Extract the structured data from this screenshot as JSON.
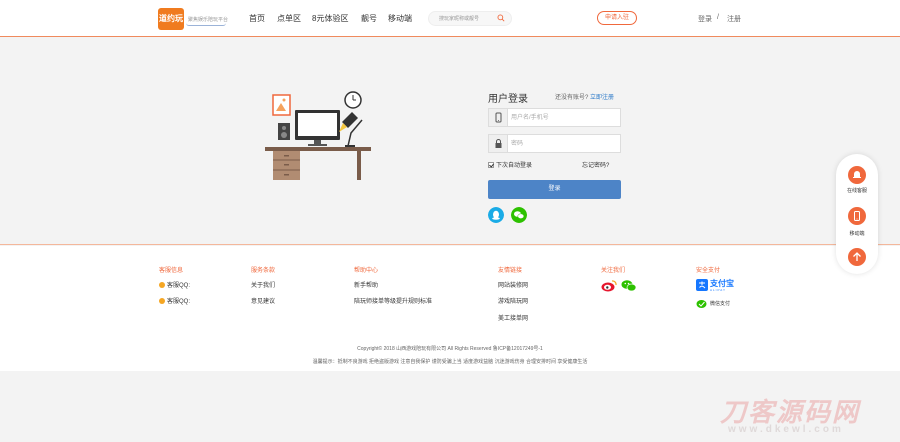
{
  "header": {
    "logo_text": "道约玩",
    "logo_tagline": "聚焦娱乐陪玩平台",
    "nav": [
      "首页",
      "点单区",
      "8元体验区",
      "靓号",
      "移动端"
    ],
    "search_placeholder": "搜玩家昵称或靓号",
    "apply_label": "申请入驻",
    "login": "登录",
    "separator": "/",
    "register": "注册"
  },
  "login": {
    "title": "用户登录",
    "has_account": "还没有账号?",
    "register_link": "立即注册",
    "username_placeholder": "用户名/手机号",
    "password_placeholder": "密码",
    "remember": "下次自动登录",
    "forgot": "忘记密码?",
    "submit": "登录"
  },
  "footer": {
    "columns": [
      {
        "title": "客服信息",
        "items": [
          "客服QQ:",
          "客服QQ:"
        ]
      },
      {
        "title": "服务条款",
        "items": [
          "关于我们",
          "意见建议"
        ]
      },
      {
        "title": "帮助中心",
        "items": [
          "新手帮助",
          "陪玩师接单等级提升规则标准"
        ]
      },
      {
        "title": "友情链接",
        "items": [
          "网站装修网",
          "游戏陪玩网",
          "美工接单网"
        ]
      },
      {
        "title": "关注我们",
        "items": []
      },
      {
        "title": "安全支付",
        "items": [
          "支付宝",
          "微信支付"
        ]
      }
    ],
    "alipay_sub": "ALIPAY",
    "copyright": "Copyright© 2018 山西游戏陪玩有限公司 All Rights Reserved 鲁ICP备12017249号-1",
    "notice": "温馨提示：抵制不良游戏 拒绝盗版游戏 注意自我保护 谨防受骗上当 适度游戏益脑 沉迷游戏伤身 合理安排时间 享受健康生活"
  },
  "sidebar": {
    "service_label": "在线客服",
    "mobile_label": "移动端"
  },
  "watermark": {
    "main": "刀客源码网",
    "sub": "www.dkewl.com"
  },
  "colors": {
    "accent": "#f0683c",
    "logo": "#f07b1f",
    "primary_button": "#4d84c7",
    "qq": "#1aabe6",
    "wechat": "#2dc100"
  }
}
